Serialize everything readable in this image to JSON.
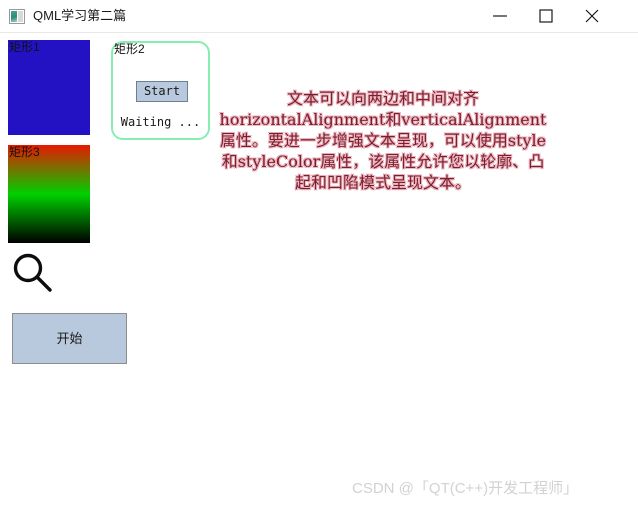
{
  "window": {
    "title": "QML学习第二篇",
    "app_icon": "qml-app-icon",
    "controls": {
      "minimize": "minimize-icon",
      "maximize": "maximize-icon",
      "close": "close-icon"
    }
  },
  "rect1": {
    "label": "矩形1",
    "color": "#2212c4"
  },
  "rect2": {
    "label": "矩形2",
    "border_color": "#86eeb0",
    "button_label": "Start",
    "status_text": "Waiting ..."
  },
  "rect3": {
    "label": "矩形3",
    "gradient": [
      "#e81800",
      "#00d000",
      "#000000"
    ]
  },
  "search": {
    "icon": "magnifier-icon"
  },
  "action": {
    "label": "开始",
    "fill": "#b9c9dd"
  },
  "styled_text": {
    "content": "文本可以向两边和中间对齐horizontalAlignment和verticalAlignment属性。要进一步增强文本呈现，可以使用style和styleColor属性，该属性允许您以轮廓、凸起和凹陷模式呈现文本。",
    "color": "#7a1f2e",
    "style_color": "#f0b9c2"
  },
  "watermark": {
    "text": "CSDN @「QT(C++)开发工程师」",
    "color": "#d2d2d2"
  }
}
